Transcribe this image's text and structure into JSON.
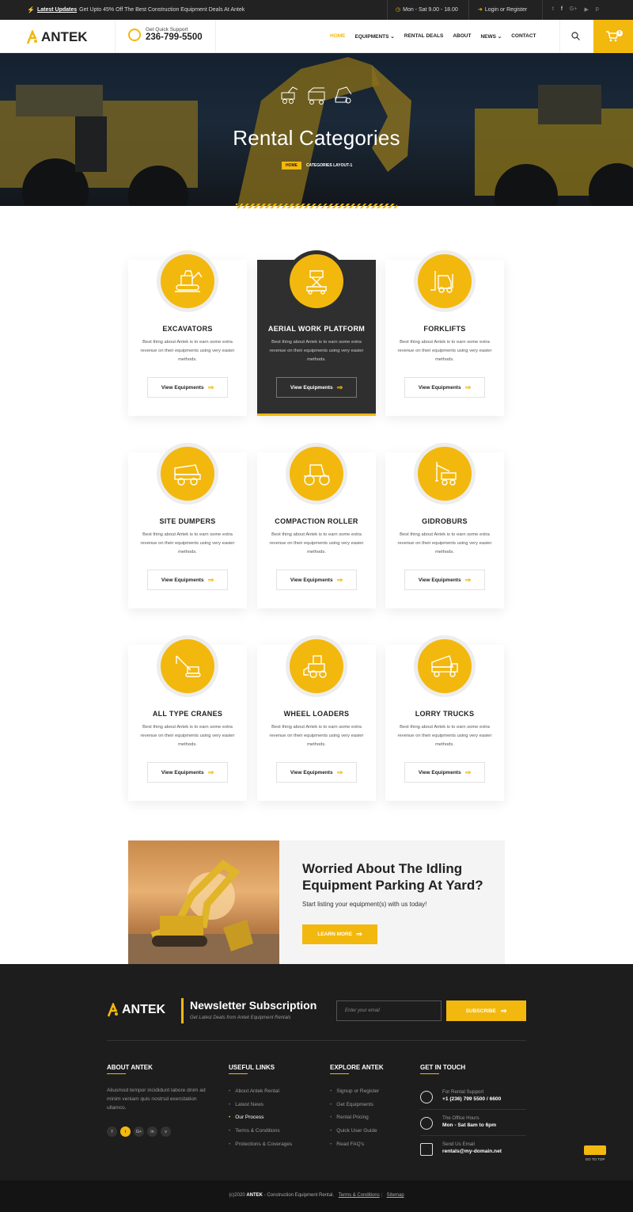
{
  "topbar": {
    "updates_label": "Latest Updates",
    "updates_text": "Get Upto 45% Off The Best Construction Equipment Deals At Antek",
    "hours": "Mon - Sat  9.00 - 18.00",
    "login": "Login or Register",
    "social_icons": [
      "twitter-icon",
      "facebook-icon",
      "google-plus-icon",
      "youtube-icon",
      "pinterest-icon"
    ]
  },
  "header": {
    "logo": "ANTEK",
    "support_label": "Get Quick Support",
    "support_phone": "236-799-5500",
    "nav": [
      "HOME",
      "EQUIPMENTS",
      "RENTAL DEALS",
      "ABOUT",
      "NEWS",
      "CONTACT"
    ],
    "active_nav": "HOME",
    "cart_count": "0",
    "accent_color": "#f3b80e"
  },
  "hero": {
    "title": "Rental Categories",
    "crumb_home": "HOME",
    "crumb_current": "CATEGORIES LAYOUT-1"
  },
  "categories": [
    {
      "title": "EXCAVATORS",
      "desc": "Best thing about Antek is to earn some extra revenue on their equipments using very easier methods.",
      "button": "View Equipments",
      "icon": "excavator-icon"
    },
    {
      "title": "AERIAL WORK PLATFORM",
      "desc": "Best thing about Antek is to earn some extra revenue on their equipments using very easier methods.",
      "button": "View Equipments",
      "icon": "aerial-platform-icon"
    },
    {
      "title": "FORKLIFTS",
      "desc": "Best thing about Antek is to earn some extra revenue on their equipments using very easier methods.",
      "button": "View Equipments",
      "icon": "forklift-icon"
    },
    {
      "title": "SITE DUMPERS",
      "desc": "Best thing about Antek is to earn some extra revenue on their equipments using very easier methods.",
      "button": "View Equipments",
      "icon": "dumper-icon"
    },
    {
      "title": "COMPACTION ROLLER",
      "desc": "Best thing about Antek is to earn some extra revenue on their equipments using very easier methods.",
      "button": "View Equipments",
      "icon": "roller-icon"
    },
    {
      "title": "GIDROBURS",
      "desc": "Best thing about Antek is to earn some extra revenue on their equipments using very easier methods.",
      "button": "View Equipments",
      "icon": "drill-rig-icon"
    },
    {
      "title": "ALL TYPE CRANES",
      "desc": "Best thing about Antek is to earn some extra revenue on their equipments using very easier methods.",
      "button": "View Equipments",
      "icon": "crane-icon"
    },
    {
      "title": "WHEEL LOADERS",
      "desc": "Best thing about Antek is to earn some extra revenue on their equipments using very easier methods.",
      "button": "View Equipments",
      "icon": "wheel-loader-icon"
    },
    {
      "title": "LORRY TRUCKS",
      "desc": "Best thing about Antek is to earn some extra revenue on their equipments using very easier methods.",
      "button": "View Equipments",
      "icon": "lorry-icon"
    }
  ],
  "promo": {
    "title": "Worried About The Idling Equipment Parking At Yard?",
    "subtitle": "Start listing your equipment(s) with us today!",
    "button": "LEARN MORE"
  },
  "footer": {
    "logo": "ANTEK",
    "newsletter_title": "Newsletter Subscription",
    "newsletter_sub": "Get Latest Deals from Antek Equipment Rentals",
    "email_placeholder": "Enter your email",
    "subscribe": "SUBSCRIBE",
    "about_title": "ABOUT ANTEK",
    "about_text": "Aliusmod tempor incididunt labore dnim ad minim veniam quis nostrsd exercitation ullamco.",
    "social": [
      "f",
      "t",
      "G+",
      "in",
      "v"
    ],
    "useful_title": "USEFUL LINKS",
    "useful_links": [
      "About Antek Rental",
      "Latest News",
      "Our Process",
      "Terms & Conditions",
      "Protections & Coverages"
    ],
    "useful_active": "Our Process",
    "explore_title": "EXPLORE ANTEK",
    "explore_links": [
      "Signup or Register",
      "Get Equipments",
      "Rental Pricing",
      "Quick User Guide",
      "Read FAQ's"
    ],
    "touch_title": "GET IN TOUCH",
    "touch": [
      {
        "label": "For Rental Support",
        "value": "+1 (236) 799 5500 / 6600",
        "icon": "phone-24-icon"
      },
      {
        "label": "The Office Hours",
        "value": "Mon - Sat 8am to 6pm",
        "icon": "clock-icon"
      },
      {
        "label": "Send Us Email",
        "value": "rentals@my-domain.net",
        "icon": "mail-icon"
      }
    ],
    "go_top": "GO TO TOP"
  },
  "bottom": {
    "copy_prefix": "(c)2020",
    "brand": "ANTEK",
    "copy_suffix": "- Construction Equipment Rental.",
    "terms": "Terms & Conditions",
    "sitemap": "Sitemap"
  }
}
